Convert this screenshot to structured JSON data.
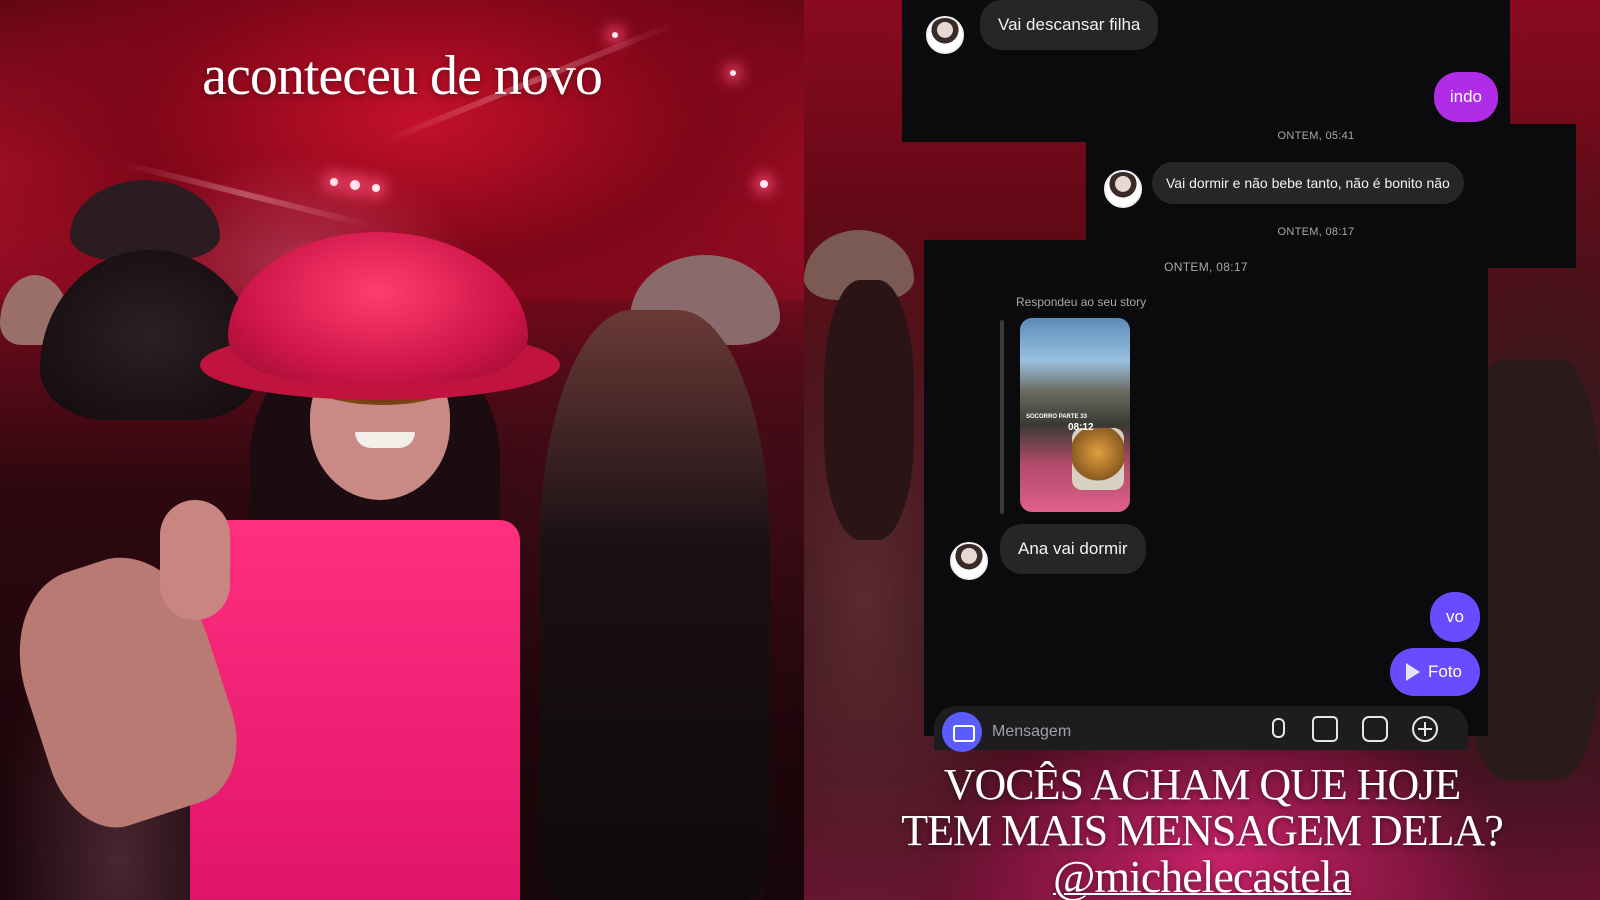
{
  "left_story": {
    "headline": "aconteceu de novo"
  },
  "chat": {
    "messages": [
      {
        "type": "incoming",
        "text": "Vai descansar filha"
      },
      {
        "type": "outgoing",
        "text": "indo",
        "color": "#b02ce6"
      },
      {
        "type": "timestamp",
        "text": "ONTEM, 05:41"
      },
      {
        "type": "incoming",
        "text": "Vai dormir e não bebe tanto, não é bonito não"
      },
      {
        "type": "timestamp",
        "text": "ONTEM, 08:17"
      },
      {
        "type": "timestamp",
        "text": "ONTEM, 08:17"
      },
      {
        "type": "story_reply_note",
        "text": "Respondeu ao seu story"
      },
      {
        "type": "story_thumbnail",
        "caption": "SOCORRO PARTE 33",
        "clock": "08:12"
      },
      {
        "type": "incoming",
        "text": "Ana vai dormir"
      },
      {
        "type": "outgoing",
        "text": "vo",
        "color": "#6a4bff"
      },
      {
        "type": "outgoing_media",
        "text": "Foto",
        "color": "#6a4bff"
      }
    ],
    "composer": {
      "placeholder": "Mensagem",
      "icons": [
        "camera-icon",
        "microphone-icon",
        "gallery-icon",
        "sticker-icon",
        "plus-icon"
      ]
    }
  },
  "right_story": {
    "caption_line1": "VOCÊS ACHAM QUE HOJE",
    "caption_line2": "TEM MAIS MENSAGEM DELA?",
    "handle": "@michelecastela"
  },
  "colors": {
    "accent_purple": "#b02ce6",
    "accent_indigo": "#6a4bff",
    "hat_pink": "#e0146a",
    "chat_bg": "#0b0b0d",
    "bubble_bg": "#262628"
  }
}
